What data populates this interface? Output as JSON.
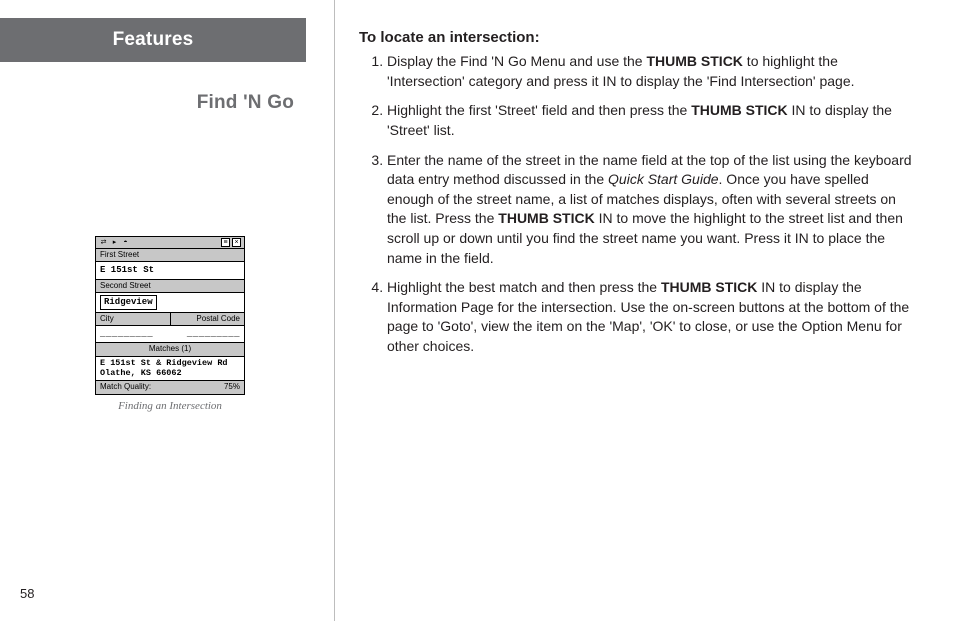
{
  "page_number": "58",
  "left": {
    "section_tab": "Features",
    "section_title": "Find 'N Go",
    "device": {
      "icon_left_1": "⇄",
      "icon_left_2": "▸",
      "icon_left_3": "◓",
      "icon_right_1": "≡",
      "icon_right_2": "×",
      "label_first_street": "First Street",
      "field_first_street": "E 151st St",
      "label_second_street": "Second Street",
      "field_second_street": "Ridgeview",
      "label_city": "City",
      "label_postal": "Postal Code",
      "dashes_left": "_________",
      "dashes_right": "_________",
      "matches_label": "Matches (1)",
      "match_line1": "E 151st St & Ridgeview Rd",
      "match_line2": "Olathe, KS 66062",
      "quality_label": "Match Quality:",
      "quality_value": "75%"
    },
    "device_caption": "Finding an Intersection"
  },
  "right": {
    "title": "To locate an intersection:",
    "steps": {
      "s1_a": "Display the Find 'N Go Menu and use the ",
      "s1_bold": "THUMB STICK",
      "s1_b": " to highlight the 'Intersection' category and press it IN to display the 'Find Intersection' page.",
      "s2_a": "Highlight the first 'Street' field and then press the ",
      "s2_bold": "THUMB STICK",
      "s2_b": " IN to display the 'Street' list.",
      "s3_a": "Enter the name of the street in the name field at the top of the list using the keyboard data entry method discussed in the ",
      "s3_italic": "Quick Start Guide",
      "s3_b": ".  Once you have spelled enough of the street name, a list of matches displays, often with several streets on the list.  Press the ",
      "s3_bold": "THUMB STICK",
      "s3_c": " IN to move the highlight to the street list and then scroll up or down until you find the street name you want.  Press it IN to place the name in the field.",
      "s4_a": "Highlight the best match and then press the ",
      "s4_bold": "THUMB STICK",
      "s4_b": " IN to display the Information Page for the intersection.  Use the on-screen buttons at the bottom of the page to 'Goto', view the item on the 'Map', 'OK' to close, or use the Option Menu for other choices."
    }
  }
}
